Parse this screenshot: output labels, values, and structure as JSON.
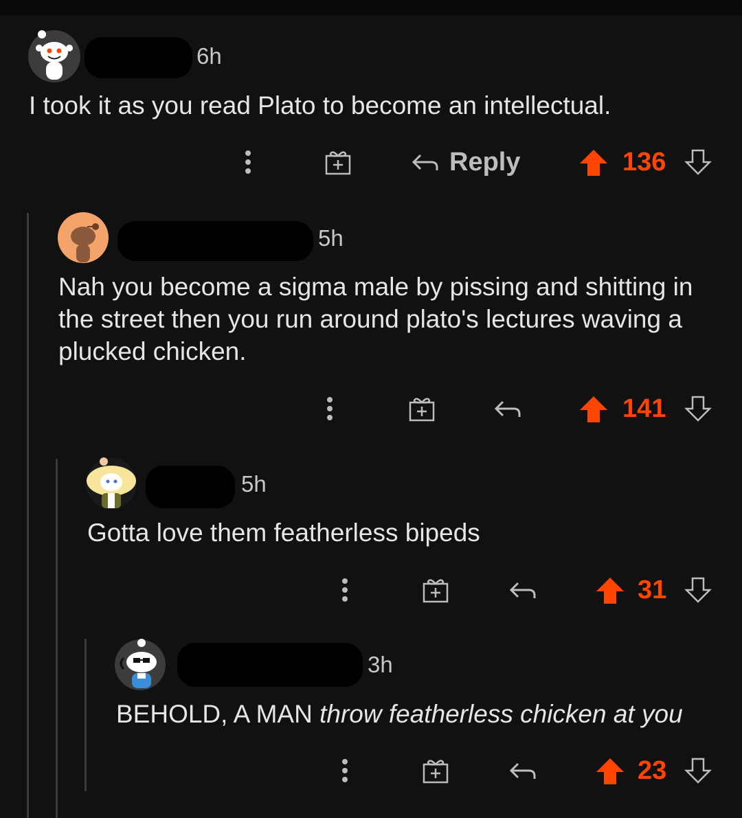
{
  "comments": [
    {
      "time": "6h",
      "body": "I took it as you read Plato to become an intellectual.",
      "reply_label": "Reply",
      "score": "136",
      "avatar_icon": "snoo-default-avatar-icon"
    },
    {
      "time": "5h",
      "body": "Nah you become a sigma male by pissing and shitting in the street then you run around plato's lectures waving a plucked chicken.",
      "score": "141",
      "avatar_icon": "snoo-orange-avatar-icon"
    },
    {
      "time": "5h",
      "body": "Gotta love them featherless bipeds",
      "score": "31",
      "avatar_icon": "snoo-blonde-avatar-icon"
    },
    {
      "time": "3h",
      "body_plain": "BEHOLD, A MAN",
      "body_italic": "throw featherless chicken at you",
      "score": "23",
      "avatar_icon": "snoo-sunglasses-avatar-icon"
    }
  ],
  "colors": {
    "background": "#111111",
    "upvote_active": "#ff4500",
    "icon_gray": "#bdbdbd",
    "thread_line": "#3a3a3a"
  },
  "icons": [
    "more-options-icon",
    "award-gift-icon",
    "reply-arrow-icon",
    "upvote-arrow-icon",
    "downvote-arrow-icon"
  ]
}
